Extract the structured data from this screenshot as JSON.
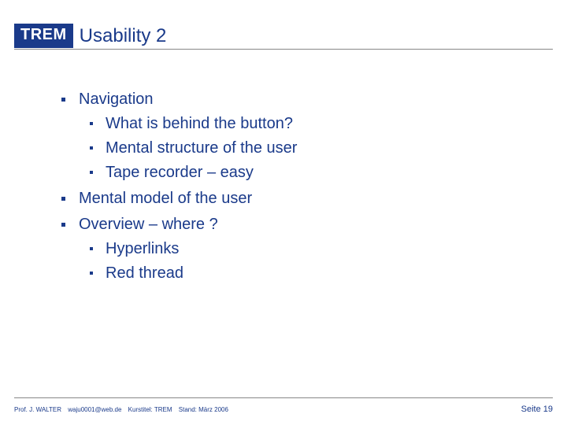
{
  "brand": "TREM",
  "title": "Usability 2",
  "bullets": {
    "b0": "Navigation",
    "b0_0": "What is behind the button?",
    "b0_1": "Mental structure of the user",
    "b0_2": "Tape recorder – easy",
    "b1": "Mental model of the user",
    "b2": "Overview – where ?",
    "b2_0": "Hyperlinks",
    "b2_1": "Red thread"
  },
  "footer": {
    "author": "Prof. J. WALTER",
    "email": "waju0001@web.de",
    "course": "Kurstitel: TREM",
    "date": "Stand: März 2006",
    "page": "Seite 19"
  }
}
